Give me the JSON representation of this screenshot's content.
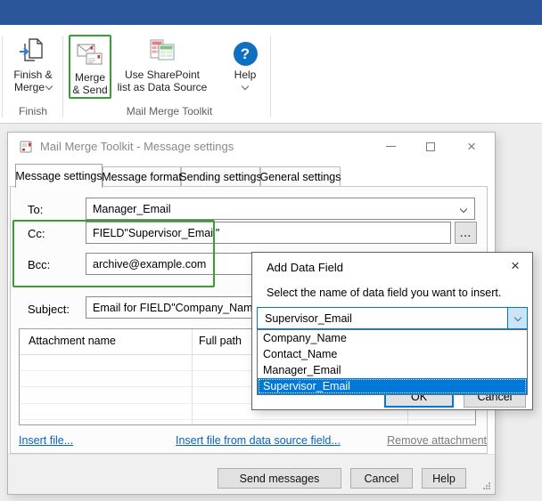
{
  "colors": {
    "accent_green": "#35a135",
    "titlebar_blue": "#2b579a",
    "focus_blue": "#0078d7",
    "selection_blue": "#0078d7",
    "help_blue": "#0f6fc0",
    "link_blue": "#0563c1",
    "disabled_link": "#7b7b7b"
  },
  "icons": {
    "close": "×",
    "ellipsis": "...",
    "help_question": "?"
  },
  "ribbon": {
    "finish_merge": {
      "line1": "Finish &",
      "line2": "Merge"
    },
    "merge_send": {
      "line1": "Merge",
      "line2": "& Send"
    },
    "sharepoint": {
      "line1": "Use SharePoint",
      "line2": "list as Data Source"
    },
    "help_label": "Help",
    "group_finish": "Finish",
    "group_toolkit": "Mail Merge Toolkit"
  },
  "dialog": {
    "title": "Mail Merge Toolkit - Message settings",
    "tabs": [
      "Message settings",
      "Message format",
      "Sending settings",
      "General settings"
    ],
    "to_label": "To:",
    "to_value": "Manager_Email",
    "cc_label": "Cc:",
    "cc_value": "FIELD\"Supervisor_Email\"",
    "bcc_label": "Bcc:",
    "bcc_value": "archive@example.com",
    "subject_label": "Subject:",
    "subject_value": "Email for FIELD\"Company_Name\"",
    "attachments_header_name": "Attachment name",
    "attachments_header_path": "Full path",
    "link_insert_file": "Insert file...",
    "link_insert_from_field": "Insert file from data source field...",
    "link_remove_attachment": "Remove attachment",
    "button_send": "Send messages",
    "button_cancel": "Cancel",
    "button_help": "Help"
  },
  "add_field_dialog": {
    "title": "Add Data Field",
    "instruction": "Select the name of data field you want to insert.",
    "combo_value": "Supervisor_Email",
    "options": [
      "Company_Name",
      "Contact_Name",
      "Manager_Email",
      "Supervisor_Email"
    ],
    "selected_option": "Supervisor_Email",
    "button_ok": "OK",
    "button_cancel": "Cancel"
  }
}
